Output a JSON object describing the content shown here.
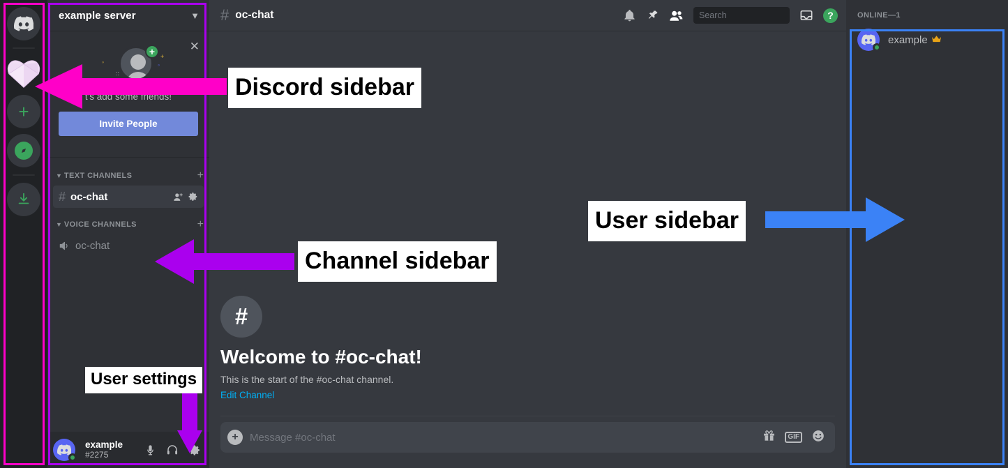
{
  "server_rail": {
    "items": [
      {
        "name": "home",
        "icon": "discord-logo-icon",
        "label": "Home"
      },
      {
        "name": "example-server",
        "icon": "heart-server-icon",
        "label": "example server"
      },
      {
        "name": "add-server",
        "icon": "plus-icon",
        "label": "Add a Server"
      },
      {
        "name": "explore",
        "icon": "compass-icon",
        "label": "Explore Public Servers"
      },
      {
        "name": "download",
        "icon": "download-icon",
        "label": "Download Apps"
      }
    ]
  },
  "channel_sidebar": {
    "server_name": "example server",
    "dropdown_icon": "chevron-down-icon",
    "invite_card": {
      "close_icon": "close-icon",
      "text": "t's add some friends!",
      "button_label": "Invite People"
    },
    "categories": [
      {
        "label": "TEXT CHANNELS",
        "add_icon": "plus-icon",
        "collapse_icon": "chevron-down-icon",
        "channels": [
          {
            "name": "oc-chat",
            "type": "text",
            "prefix": "#",
            "active": true,
            "row_icons": [
              "add-member-icon",
              "gear-icon"
            ]
          }
        ]
      },
      {
        "label": "VOICE CHANNELS",
        "add_icon": "plus-icon",
        "collapse_icon": "chevron-down-icon",
        "channels": [
          {
            "name": "oc-chat",
            "type": "voice",
            "prefix": "speaker-icon",
            "active": false,
            "row_icons": []
          }
        ]
      }
    ],
    "user_panel": {
      "username": "example",
      "discriminator": "#2275",
      "status": "online",
      "buttons": [
        {
          "name": "mute-button",
          "icon": "microphone-icon"
        },
        {
          "name": "deafen-button",
          "icon": "headphones-icon"
        },
        {
          "name": "user-settings-button",
          "icon": "gear-icon"
        }
      ]
    }
  },
  "chat": {
    "header": {
      "hash": "#",
      "channel_name": "oc-chat",
      "icons": [
        {
          "name": "notifications-button",
          "icon": "bell-icon"
        },
        {
          "name": "pinned-messages-button",
          "icon": "pin-icon"
        },
        {
          "name": "member-list-button",
          "icon": "members-icon"
        }
      ],
      "search": {
        "placeholder": "Search",
        "value": "",
        "icon": "search-icon"
      },
      "inbox": {
        "name": "inbox-button",
        "icon": "inbox-icon"
      },
      "help": {
        "name": "help-button",
        "icon": "question-mark-icon",
        "label": "?",
        "color": "#3ba55d"
      }
    },
    "welcome": {
      "hash": "#",
      "title": "Welcome to #oc-chat!",
      "subtitle": "This is the start of the #oc-chat channel.",
      "link": "Edit Channel"
    },
    "composer": {
      "add_icon": "plus-circle-icon",
      "placeholder": "Message #oc-chat",
      "value": "",
      "icons": [
        {
          "name": "gift-button",
          "icon": "gift-icon",
          "label": ""
        },
        {
          "name": "gif-button",
          "icon": "gif-icon",
          "label": "GIF"
        },
        {
          "name": "emoji-button",
          "icon": "emoji-icon",
          "label": ""
        }
      ]
    }
  },
  "member_sidebar": {
    "category": "ONLINE—1",
    "members": [
      {
        "name": "example",
        "status": "online",
        "badge": "crown-icon",
        "badge_glyph": "♛"
      }
    ]
  },
  "annotations": [
    {
      "name": "discord-sidebar",
      "label": "Discord sidebar",
      "color": "#ff00c8"
    },
    {
      "name": "channel-sidebar",
      "label": "Channel sidebar",
      "color": "#aa00ee"
    },
    {
      "name": "user-sidebar",
      "label": "User sidebar",
      "color": "#3b82f6"
    },
    {
      "name": "user-settings",
      "label": "User settings",
      "color": "#aa00ee"
    }
  ]
}
